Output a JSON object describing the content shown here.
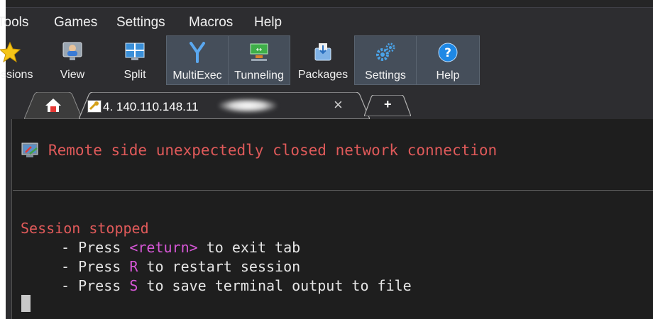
{
  "menu": {
    "items": [
      "Tools",
      "Games",
      "Settings",
      "Macros",
      "Help"
    ]
  },
  "toolbar": {
    "sessions_label": "Sessions",
    "view_label": "View",
    "split_label": "Split",
    "multiexec_label": "MultiExec",
    "tunneling_label": "Tunneling",
    "packages_label": "Packages",
    "settings_label": "Settings",
    "help_label": "Help"
  },
  "tabs": {
    "session_tab_label": "4. 140.110.148.11",
    "close_glyph": "×",
    "new_tab_glyph": "+"
  },
  "terminal": {
    "error_message": "Remote side unexpectedly closed network connection",
    "session_stopped": "Session stopped",
    "line1_prefix": "- Press ",
    "line1_key": "<return>",
    "line1_suffix": " to exit tab",
    "line2_prefix": "- Press ",
    "line2_key": "R",
    "line2_suffix": " to restart session",
    "line3_prefix": "- Press ",
    "line3_key": "S",
    "line3_suffix": " to save terminal output to file"
  },
  "colors": {
    "error_text": "#e05a5a",
    "key_highlight": "#d857d8",
    "terminal_bg": "#1e1e1e",
    "chrome_bg": "#2d2d30"
  },
  "icons": {
    "sessions": "star-icon",
    "view": "monitor-user-icon",
    "split": "split-window-icon",
    "multiexec": "fork-arrows-icon",
    "tunneling": "tunnel-icon",
    "packages": "package-icon",
    "settings": "gears-icon",
    "help": "help-circle-icon",
    "home": "home-icon",
    "session_tab": "terminal-key-icon",
    "warning": "disconnected-warning-icon"
  }
}
